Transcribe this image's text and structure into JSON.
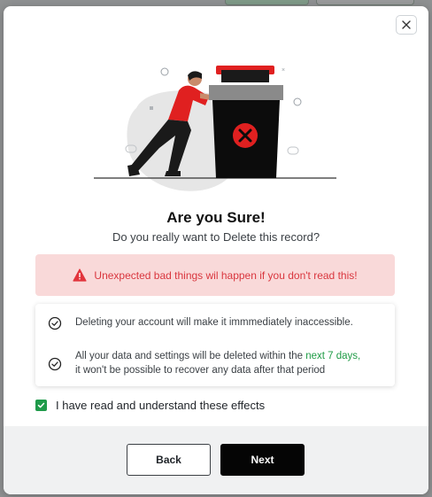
{
  "dialog": {
    "title": "Are you Sure!",
    "subtitle": "Do you really want to Delete this record?",
    "close_icon": "close-icon"
  },
  "alert": {
    "icon": "warning-triangle-icon",
    "text": "Unexpected bad things wil happen if you don't read this!",
    "color": "#d9363e",
    "background": "#f9d9d9"
  },
  "info": {
    "line1": "Deleting your account will make it immmediately inaccessible.",
    "line2_part1": "All your data and settings will be deleted within the ",
    "line2_highlight": "next 7 days,",
    "line2_part2": "it won't be possible to recover any data after that period",
    "highlight_color": "#1e9b45"
  },
  "consent": {
    "checked": true,
    "label": "I have read and understand these effects"
  },
  "footer": {
    "back_label": "Back",
    "next_label": "Next"
  }
}
